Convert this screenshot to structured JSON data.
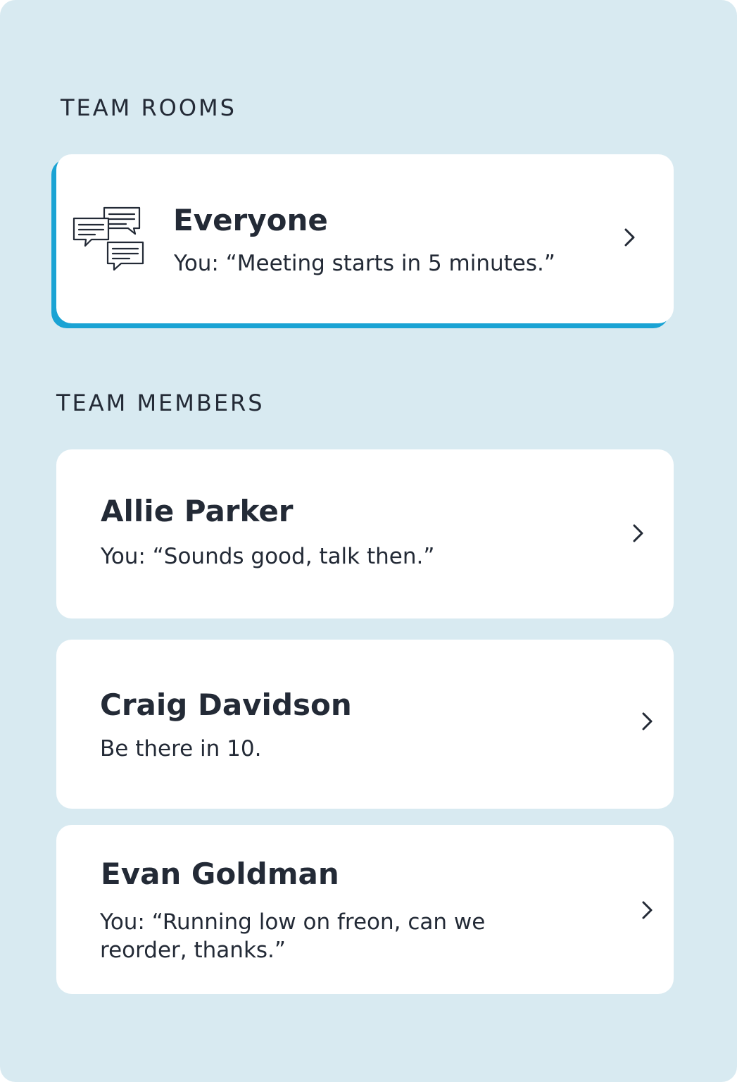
{
  "sections": {
    "rooms_label": "TEAM ROOMS",
    "members_label": "TEAM MEMBERS"
  },
  "rooms": [
    {
      "title": "Everyone",
      "last_message": "You: “Meeting starts in 5 minutes.”",
      "icon": "chat-bubbles-icon",
      "selected": true
    }
  ],
  "members": [
    {
      "name": "Allie Parker",
      "last_message": "You: “Sounds good, talk then.”"
    },
    {
      "name": "Craig Davidson",
      "last_message": "Be there in 10."
    },
    {
      "name": "Evan Goldman",
      "last_message": "You: “Running low on freon, can we reorder, thanks.”"
    }
  ],
  "colors": {
    "background": "#d8eaf1",
    "card": "#ffffff",
    "text": "#232a36",
    "accent": "#1aa3d4"
  }
}
